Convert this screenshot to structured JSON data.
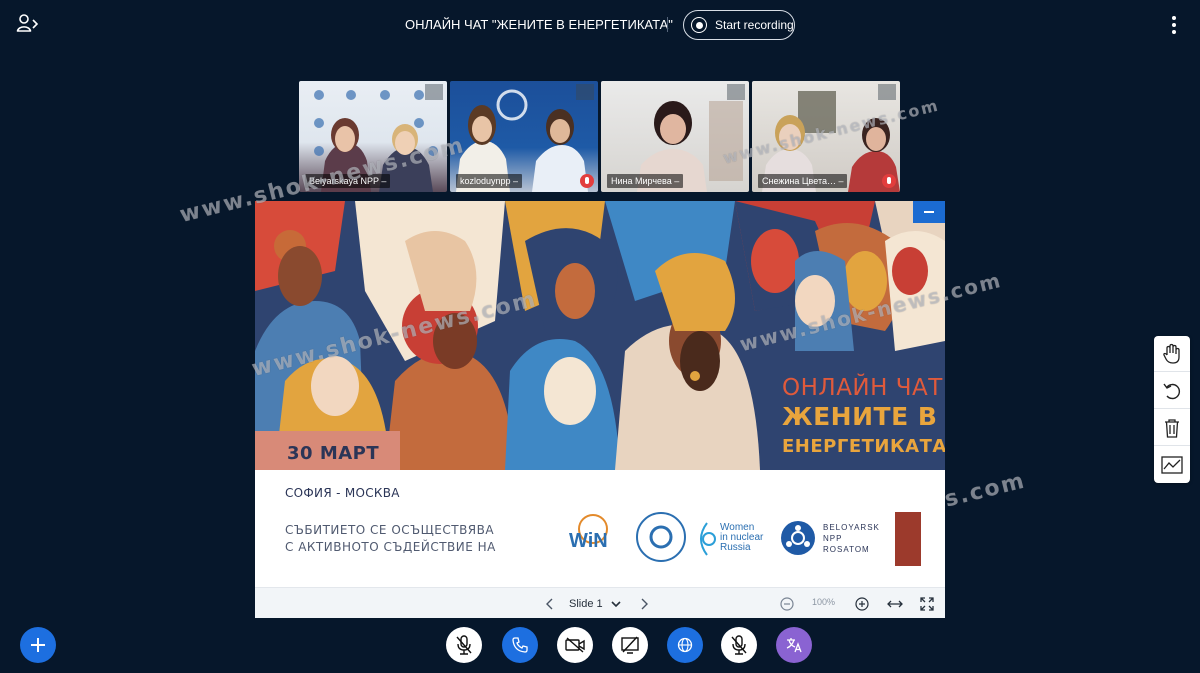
{
  "topbar": {
    "title": "ОНЛАЙН ЧАТ \"ЖЕНИТЕ В ЕНЕРГЕТИКАТА\"",
    "record_label": "Start recording"
  },
  "webcams": [
    {
      "name": "Belyarskaya NPP –"
    },
    {
      "name": "kozloduynpp –"
    },
    {
      "name": "Нина Мирчева –"
    },
    {
      "name": "Снежина Цвета… –"
    }
  ],
  "slide": {
    "date": "30 МАРТ",
    "heading_line1": "ОНЛАЙН ЧАТ",
    "heading_line2": "ЖЕНИТЕ В",
    "heading_line3": "ЕНЕРГЕТИКАТА",
    "cities": "СОФИЯ - МОСКВА",
    "support_line1": "СЪБИТИЕТО СЕ ОСЪЩЕСТВЯВА",
    "support_line2": "С АКТИВНОТО СЪДЕЙСТВИЕ НА",
    "logo_win": "WiN",
    "logo_women_l1": "Women",
    "logo_women_l2": "in nuclear",
    "logo_women_l3": "Russia",
    "logo_bel_l1": "BELOYARSK",
    "logo_bel_l2": "NPP",
    "logo_bel_l3": "ROSATOM"
  },
  "presentation_toolbar": {
    "slide_label": "Slide 1",
    "zoom": "100%"
  },
  "watermarks": [
    "www.shok-news.com",
    "www.shok-news.com",
    "www.shok-news.com",
    "www.shok-news.com",
    "s.com"
  ],
  "colors": {
    "background": "#06172b",
    "accent_blue": "#1d6fe0",
    "translate_purple": "#8a63d2",
    "slide_navy": "#2f4470",
    "slide_orange": "#e05a3b",
    "slide_gold": "#e9a53d"
  },
  "icons": {
    "user_list": "users-toggle-icon",
    "record": "record-icon",
    "options": "more-vertical-icon",
    "actions": "plus-icon",
    "mic": "microphone-muted-icon",
    "audio": "phone-icon",
    "video": "camera-off-icon",
    "screenshare": "screenshare-off-icon",
    "settings": "globe-icon",
    "translate": "translate-icon"
  }
}
